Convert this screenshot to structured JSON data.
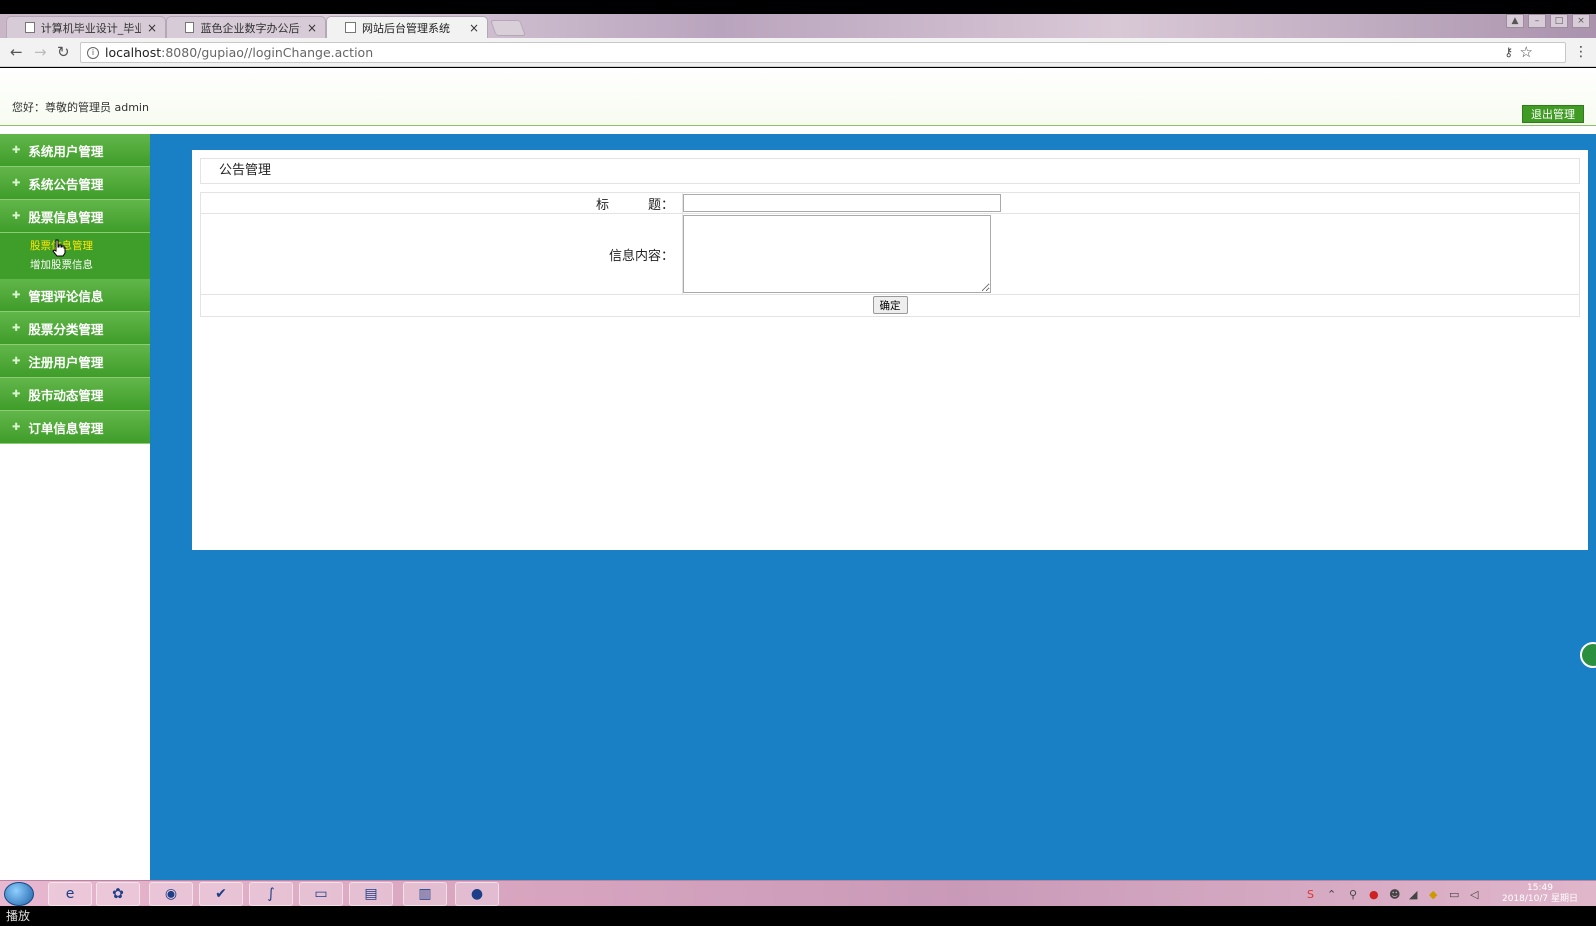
{
  "browser": {
    "tabs": [
      {
        "title": "计算机毕业设计_毕业设",
        "active": false
      },
      {
        "title": "蓝色企业数字办公后台管",
        "active": false
      },
      {
        "title": "网站后台管理系统",
        "active": true
      }
    ],
    "close_glyph": "×",
    "url_host": "localhost",
    "url_path": ":8080/gupiao//loginChange.action"
  },
  "header": {
    "greeting": "您好：尊敬的管理员 admin",
    "logout_label": "退出管理"
  },
  "sidebar": {
    "items": [
      {
        "label": "系统用户管理"
      },
      {
        "label": "系统公告管理"
      },
      {
        "label": "股票信息管理"
      },
      {
        "label": "管理评论信息"
      },
      {
        "label": "股票分类管理"
      },
      {
        "label": "注册用户管理"
      },
      {
        "label": "股市动态管理"
      },
      {
        "label": "订单信息管理"
      }
    ],
    "submenu": [
      {
        "label": "股票信息管理",
        "current": true
      },
      {
        "label": "增加股票信息",
        "current": false
      }
    ]
  },
  "panel": {
    "title": "公告管理",
    "form": {
      "title_label": "标　　　题：",
      "title_value": "",
      "content_label": "信息内容：",
      "content_value": "",
      "submit_label": "确定"
    }
  },
  "taskbar": {
    "apps": [
      "ie-icon",
      "app-icon",
      "chrome-icon",
      "tool-icon",
      "eclipse-icon",
      "notepad-icon",
      "folder-icon",
      "chart-icon",
      "media-icon"
    ],
    "clock_time": "15:49",
    "clock_date": "2018/10/7 星期日"
  },
  "status": {
    "text": "播放"
  },
  "colors": {
    "accent_green": "#3f9d2a",
    "content_blue": "#1a80c6"
  }
}
